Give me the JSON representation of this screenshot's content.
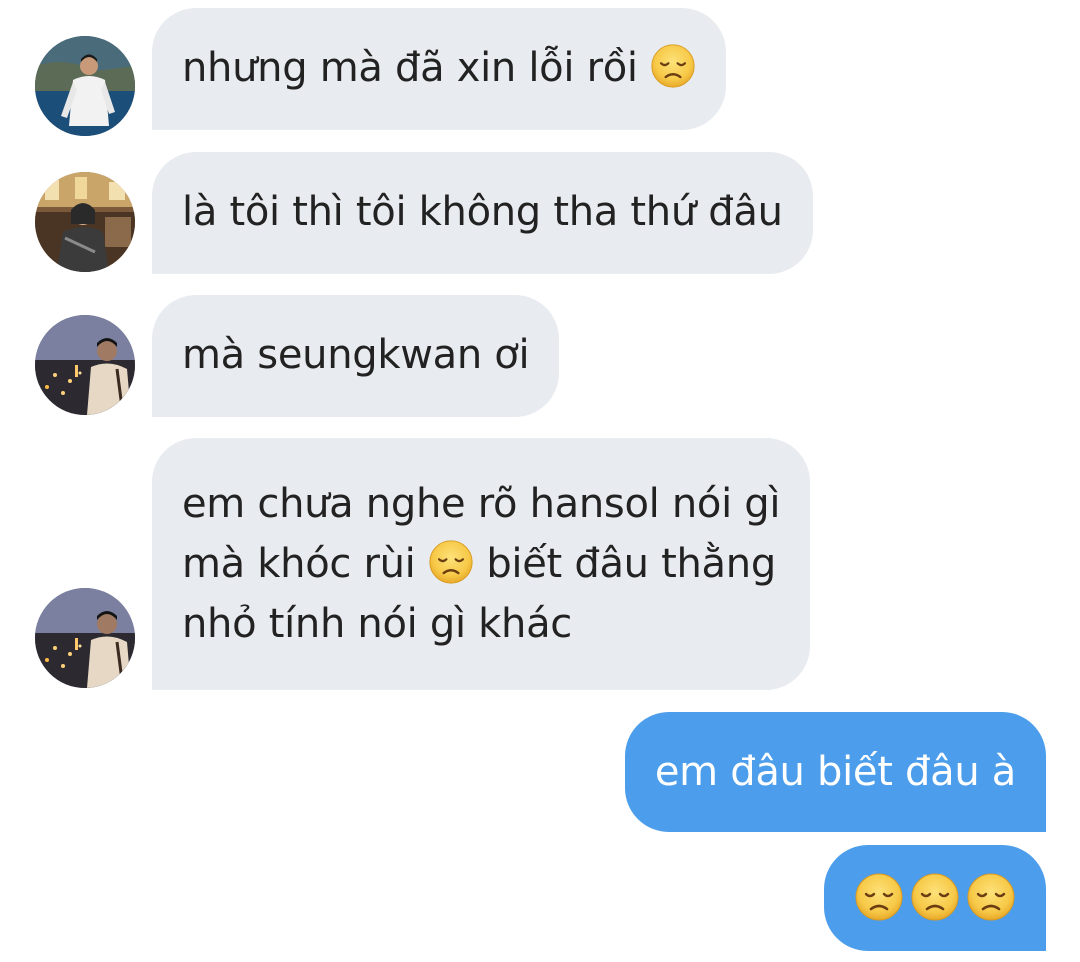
{
  "conversation": {
    "messages": [
      {
        "direction": "incoming",
        "avatar_icon": "avatar-man-white-shirt-icon",
        "line1": "nhưng mà đã xin lỗi rồi",
        "emoji": "disappointed-face-icon"
      },
      {
        "direction": "incoming",
        "avatar_icon": "avatar-person-cafe-icon",
        "line1": "là tôi thì tôi không tha thứ đâu"
      },
      {
        "direction": "incoming",
        "avatar_icon": "avatar-man-night-city-icon",
        "line1": "mà seungkwan ơi"
      },
      {
        "direction": "incoming",
        "avatar_icon": "avatar-man-night-city-icon",
        "line1": "em chưa nghe rõ hansol nói gì",
        "line2_before_emoji": "mà khóc rùi",
        "line2_after_emoji": "biết đâu thằng",
        "line3": "nhỏ tính nói gì khác",
        "emoji": "disappointed-face-icon"
      },
      {
        "direction": "outgoing",
        "line1": "em đâu biết đâu à"
      },
      {
        "direction": "outgoing",
        "emoji_count": 3,
        "emoji": "disappointed-face-icon"
      }
    ]
  },
  "colors": {
    "incoming_bubble": "#e8ebef",
    "incoming_text": "#222222",
    "outgoing_bubble": "#4c9deb",
    "outgoing_text": "#ffffff",
    "emoji_face": "#f7c948"
  }
}
